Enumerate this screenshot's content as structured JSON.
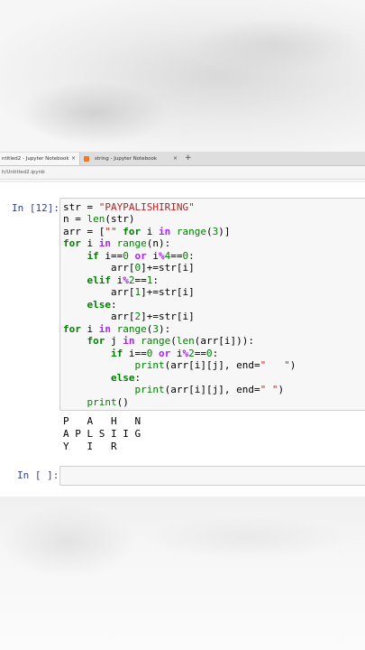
{
  "browser": {
    "tabs": [
      {
        "label": "ntitled2 - Jupyter Notebook",
        "close": "×",
        "active": true
      },
      {
        "label": "string - Jupyter Notebook",
        "close": "×",
        "active": false
      }
    ],
    "new_tab": "+",
    "url": "h/Untitled2.ipynb"
  },
  "cells": [
    {
      "prompt": "In [12]:",
      "code": [
        "str = \"PAYPALISHIRING\"",
        "n = len(str)",
        "arr = [\"\" for i in range(3)]",
        "for i in range(n):",
        "    if i==0 or i%4==0:",
        "        arr[0]+=str[i]",
        "    elif i%2==1:",
        "        arr[1]+=str[i]",
        "    else:",
        "        arr[2]+=str[i]",
        "for i in range(3):",
        "    for j in range(len(arr[i])):",
        "        if i==0 or i%2==0:",
        "            print(arr[i][j], end=\"   \")",
        "        else:",
        "            print(arr[i][j], end=\" \")",
        "    print()"
      ],
      "output": [
        "P   A   H   N",
        "A P L S I I G",
        "Y   I   R"
      ]
    },
    {
      "prompt": "In [ ]:",
      "code": []
    }
  ]
}
